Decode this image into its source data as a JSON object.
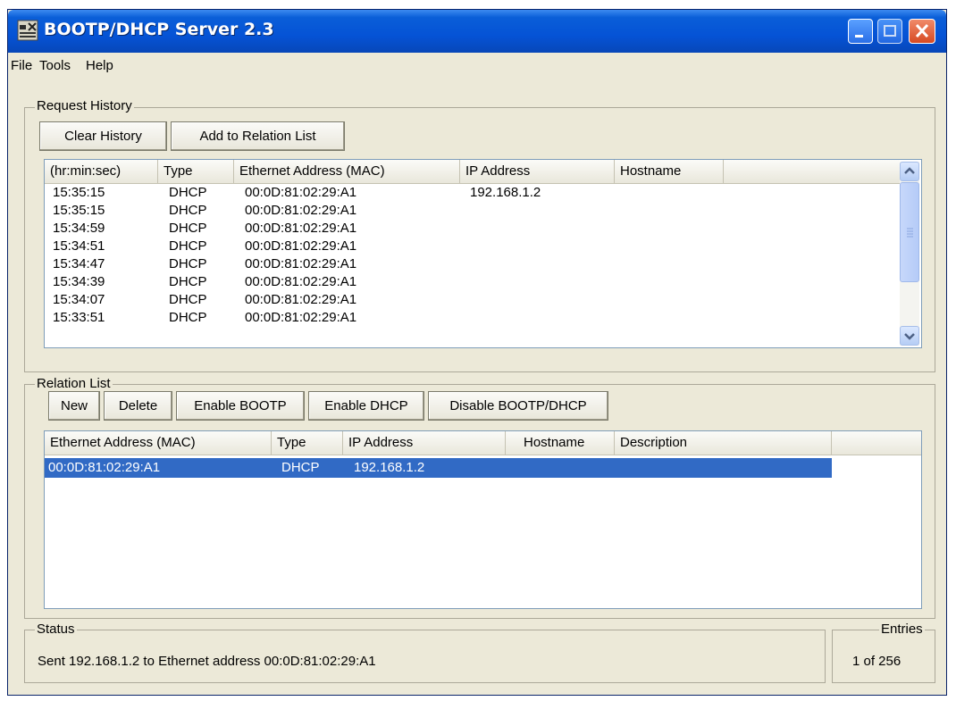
{
  "window": {
    "title": "BOOTP/DHCP Server 2.3"
  },
  "menu": [
    "File",
    "Tools",
    "Help"
  ],
  "request_history": {
    "label": "Request History",
    "buttons": {
      "clear": "Clear History",
      "add": "Add to Relation List"
    },
    "columns": [
      "(hr:min:sec)",
      "Type",
      "Ethernet Address (MAC)",
      "IP Address",
      "Hostname"
    ],
    "rows": [
      {
        "time": "15:35:15",
        "type": "DHCP",
        "mac": "00:0D:81:02:29:A1",
        "ip": "192.168.1.2",
        "host": ""
      },
      {
        "time": "15:35:15",
        "type": "DHCP",
        "mac": "00:0D:81:02:29:A1",
        "ip": "",
        "host": ""
      },
      {
        "time": "15:34:59",
        "type": "DHCP",
        "mac": "00:0D:81:02:29:A1",
        "ip": "",
        "host": ""
      },
      {
        "time": "15:34:51",
        "type": "DHCP",
        "mac": "00:0D:81:02:29:A1",
        "ip": "",
        "host": ""
      },
      {
        "time": "15:34:47",
        "type": "DHCP",
        "mac": "00:0D:81:02:29:A1",
        "ip": "",
        "host": ""
      },
      {
        "time": "15:34:39",
        "type": "DHCP",
        "mac": "00:0D:81:02:29:A1",
        "ip": "",
        "host": ""
      },
      {
        "time": "15:34:07",
        "type": "DHCP",
        "mac": "00:0D:81:02:29:A1",
        "ip": "",
        "host": ""
      },
      {
        "time": "15:33:51",
        "type": "DHCP",
        "mac": "00:0D:81:02:29:A1",
        "ip": "",
        "host": ""
      }
    ]
  },
  "relation_list": {
    "label": "Relation List",
    "buttons": {
      "new": "New",
      "delete": "Delete",
      "enable_bootp": "Enable BOOTP",
      "enable_dhcp": "Enable DHCP",
      "disable": "Disable BOOTP/DHCP"
    },
    "columns": [
      "Ethernet Address (MAC)",
      "Type",
      "IP Address",
      "Hostname",
      "Description"
    ],
    "rows": [
      {
        "mac": "00:0D:81:02:29:A1",
        "type": "DHCP",
        "ip": "192.168.1.2",
        "host": "",
        "desc": "",
        "selected": true
      }
    ]
  },
  "status": {
    "label": "Status",
    "text": "Sent 192.168.1.2 to Ethernet address 00:0D:81:02:29:A1"
  },
  "entries": {
    "label": "Entries",
    "text": "1 of 256"
  },
  "icons": {
    "scroll_up": "chevron-up-icon",
    "scroll_down": "chevron-down-icon",
    "minimize": "minimize-icon",
    "maximize": "maximize-icon",
    "close": "close-icon"
  },
  "colors": {
    "titlebar": "#0553d6",
    "selection": "#316ac5",
    "window_bg": "#ece9d8"
  }
}
